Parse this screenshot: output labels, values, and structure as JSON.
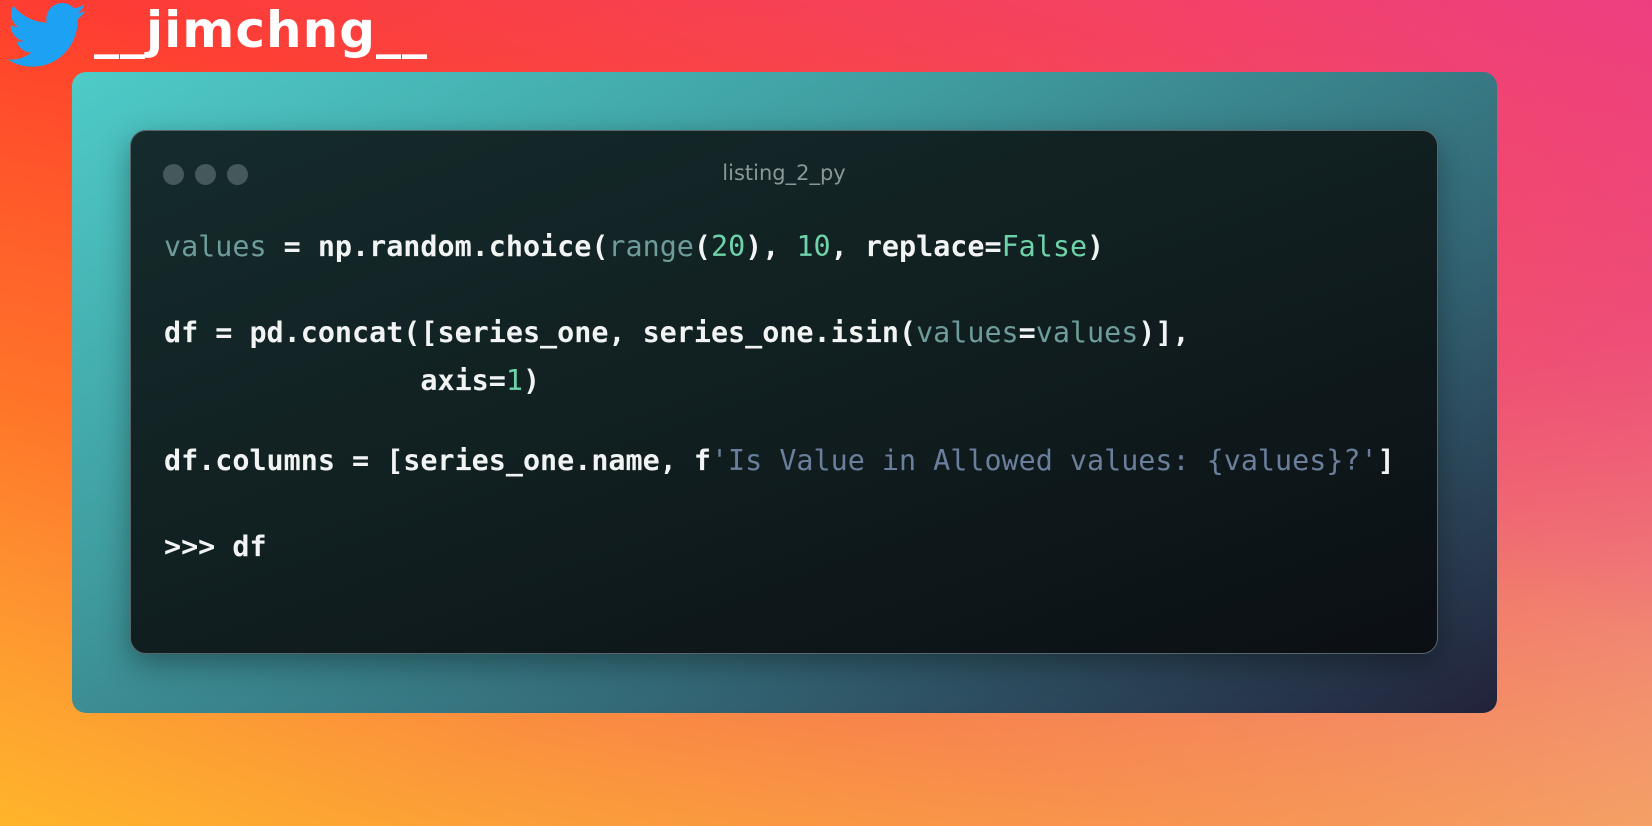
{
  "header": {
    "handle": "__jimchng__",
    "icon": "twitter-bird-icon",
    "icon_color": "#1da1f2"
  },
  "window": {
    "title": "listing_2_py",
    "controls": [
      "window-dot",
      "window-dot",
      "window-dot"
    ]
  },
  "code": {
    "lines": [
      {
        "tokens": [
          {
            "kind": "var",
            "text": "values"
          },
          {
            "kind": "plain",
            "text": " = np.random.choice("
          },
          {
            "kind": "var",
            "text": "range"
          },
          {
            "kind": "plain",
            "text": "("
          },
          {
            "kind": "num",
            "text": "20"
          },
          {
            "kind": "plain",
            "text": "), "
          },
          {
            "kind": "num",
            "text": "10"
          },
          {
            "kind": "plain",
            "text": ", replace="
          },
          {
            "kind": "num",
            "text": "False"
          },
          {
            "kind": "plain",
            "text": ")"
          }
        ]
      },
      {
        "tokens": [
          {
            "kind": "plain",
            "text": "df = pd.concat([series_one, series_one.isin("
          },
          {
            "kind": "var",
            "text": "values"
          },
          {
            "kind": "plain",
            "text": "="
          },
          {
            "kind": "var",
            "text": "values"
          },
          {
            "kind": "plain",
            "text": ")],"
          }
        ]
      },
      {
        "tokens": [
          {
            "kind": "plain",
            "text": "               axis="
          },
          {
            "kind": "num",
            "text": "1"
          },
          {
            "kind": "plain",
            "text": ")"
          }
        ]
      },
      {
        "tokens": [
          {
            "kind": "plain",
            "text": "df.columns = [series_one.name, f"
          },
          {
            "kind": "str",
            "text": "'Is Value in Allowed values: {values}?'"
          },
          {
            "kind": "plain",
            "text": "]"
          }
        ]
      },
      {
        "tokens": [
          {
            "kind": "plain",
            "text": ">>> df"
          }
        ]
      }
    ]
  }
}
